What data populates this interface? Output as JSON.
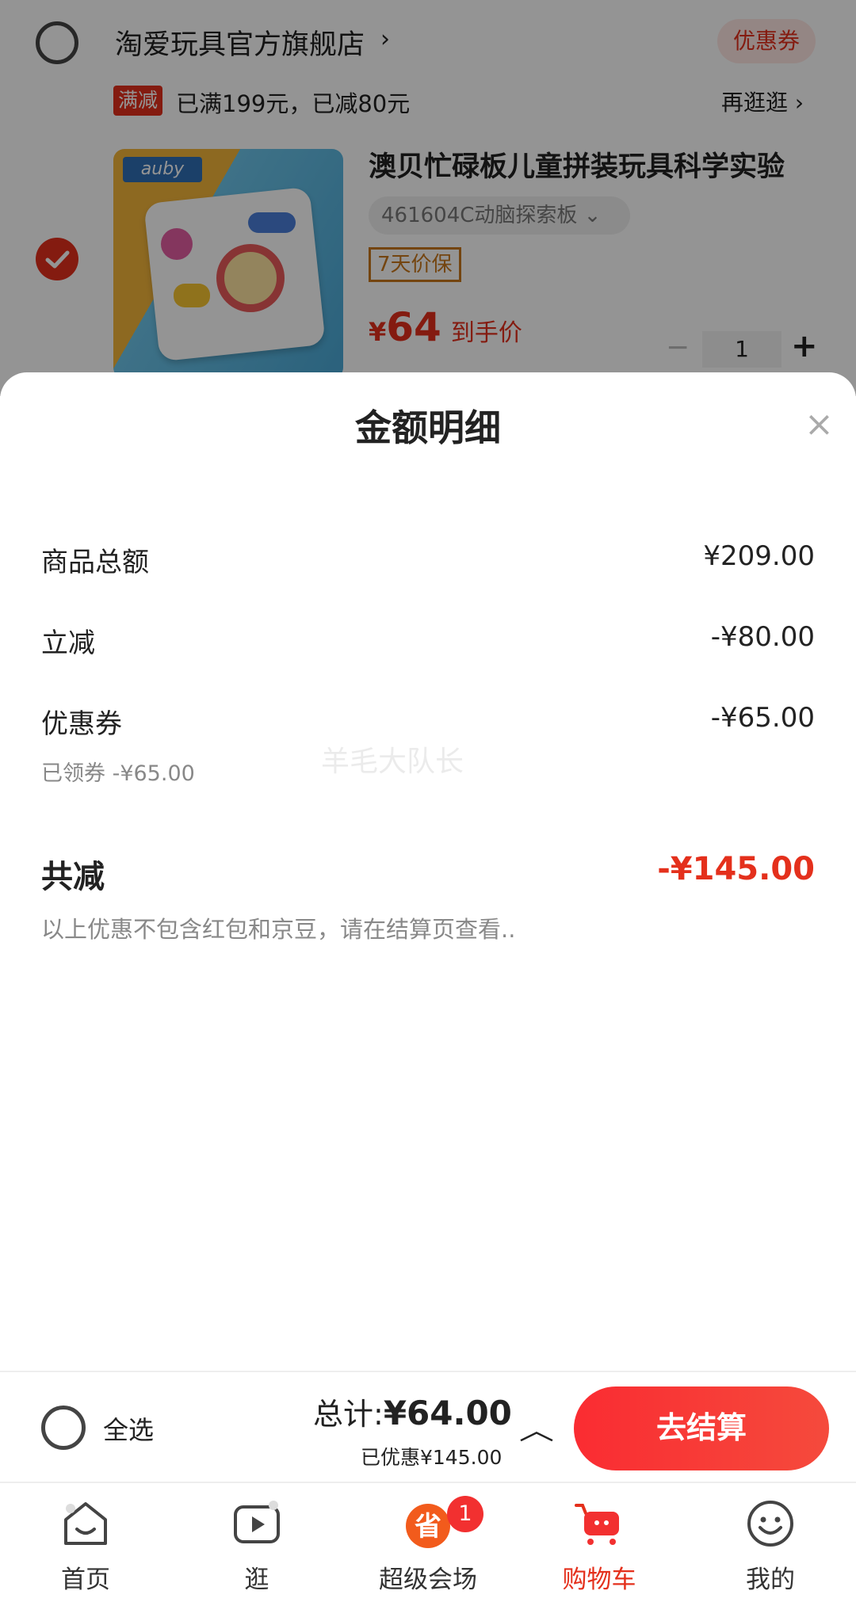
{
  "store": {
    "name": "淘爱玩具官方旗舰店",
    "chevron": "›",
    "coupon_label": "优惠券",
    "promo_tag": "满减",
    "promo_text": "已满199元，已减80元",
    "promo_more": "再逛逛 ›"
  },
  "item": {
    "brand": "auby",
    "title": "澳贝忙碌板儿童拼装玩具科学实验",
    "sku": "461604C动脑探索板 ⌄",
    "badge": "7天价保",
    "price_symbol": "¥",
    "price_value": "64",
    "price_suffix": "到手价",
    "qty_minus": "−",
    "qty": "1",
    "qty_plus": "+",
    "checked": true
  },
  "sheet": {
    "title": "金额明细",
    "close_icon": "×",
    "rows": [
      {
        "label": "商品总额",
        "value": "¥209.00"
      },
      {
        "label": "立减",
        "value": "-¥80.00"
      },
      {
        "label": "优惠券",
        "value": "-¥65.00",
        "sub": "已领券 -¥65.00"
      }
    ],
    "total_label": "共减",
    "total_value": "-¥145.00",
    "note": "以上优惠不包含红包和京豆，请在结算页查看..",
    "watermark": "羊毛大队长"
  },
  "checkout": {
    "select_all": "全选",
    "total_label": "总计:",
    "total_amount": "¥64.00",
    "saved": "已优惠¥145.00",
    "expand_icon": "︿",
    "button": "去结算"
  },
  "tabs": [
    {
      "label": "首页",
      "icon": "home-icon"
    },
    {
      "label": "逛",
      "icon": "video-play-icon"
    },
    {
      "label": "超级会场",
      "icon": "super-venue-icon",
      "badge": "1"
    },
    {
      "label": "购物车",
      "icon": "cart-icon",
      "active": true
    },
    {
      "label": "我的",
      "icon": "profile-smile-icon"
    }
  ],
  "colors": {
    "accent": "#e4301c",
    "button": "#fa2c32",
    "muted": "#888888"
  }
}
